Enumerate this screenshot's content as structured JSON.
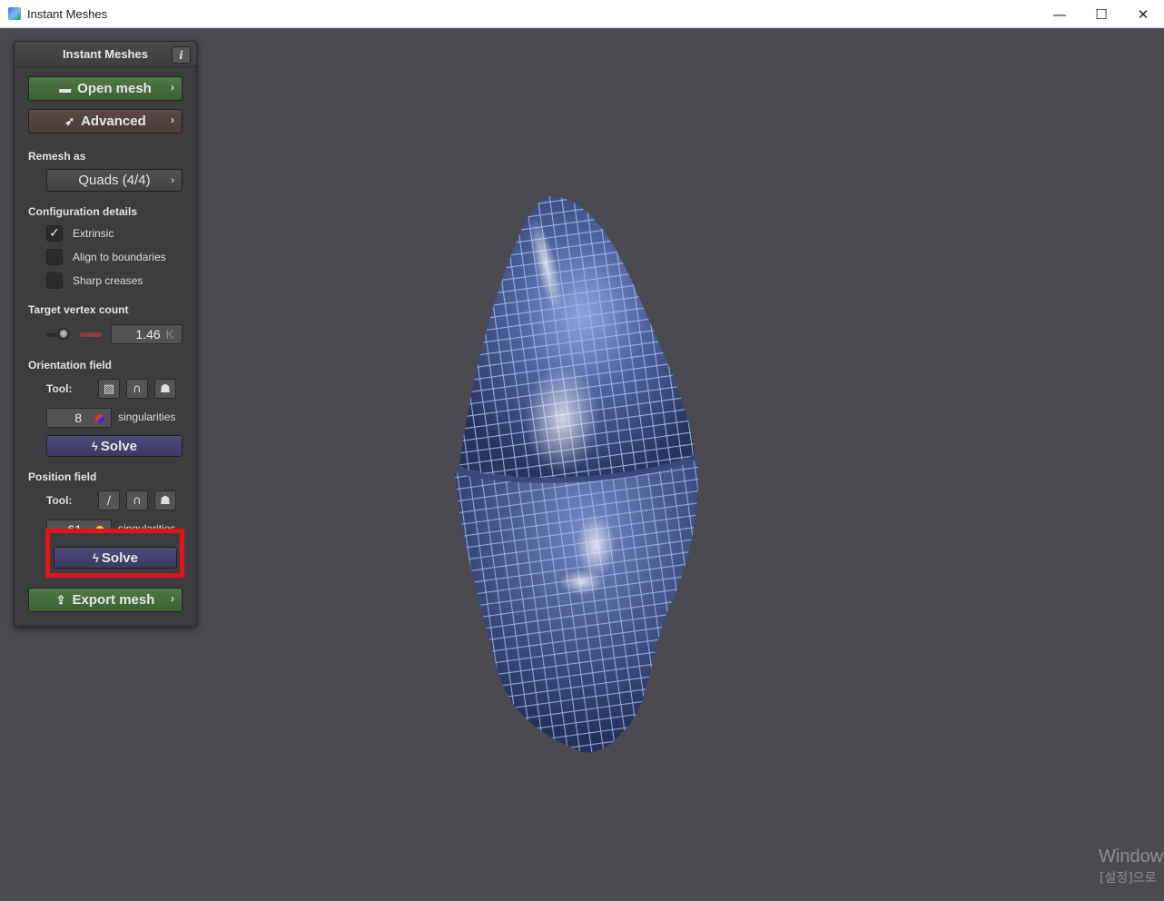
{
  "window": {
    "title": "Instant Meshes",
    "minimize": "—",
    "maximize": "☐",
    "close": "✕"
  },
  "panel": {
    "title": "Instant Meshes",
    "info_label": "i",
    "open_mesh": "Open mesh",
    "advanced": "Advanced",
    "remesh_as_label": "Remesh as",
    "remesh_mode": "Quads (4/4)",
    "config_label": "Configuration details",
    "options": [
      {
        "label": "Extrinsic",
        "checked": true
      },
      {
        "label": "Align to boundaries",
        "checked": false
      },
      {
        "label": "Sharp creases",
        "checked": false
      }
    ],
    "target_vertex_label": "Target vertex count",
    "target_vertex_value": "1.46",
    "target_vertex_unit": "K",
    "orientation_label": "Orientation field",
    "orientation_tool_label": "Tool:",
    "orientation_singularities": "8",
    "singularities_label": "singularities",
    "orientation_solve": "Solve",
    "position_label": "Position field",
    "position_tool_label": "Tool:",
    "position_singularities": "61",
    "position_solve": "Solve",
    "export_mesh": "Export mesh"
  },
  "colors": {
    "accent_green": "#4f7a45",
    "solve_blue": "#4d4b78",
    "highlight_red": "#e3121b",
    "mesh_blue": "#4a5f9a",
    "background": "#4b4a51"
  },
  "watermark": {
    "line1": "Window",
    "line2": "[설정]으로"
  }
}
